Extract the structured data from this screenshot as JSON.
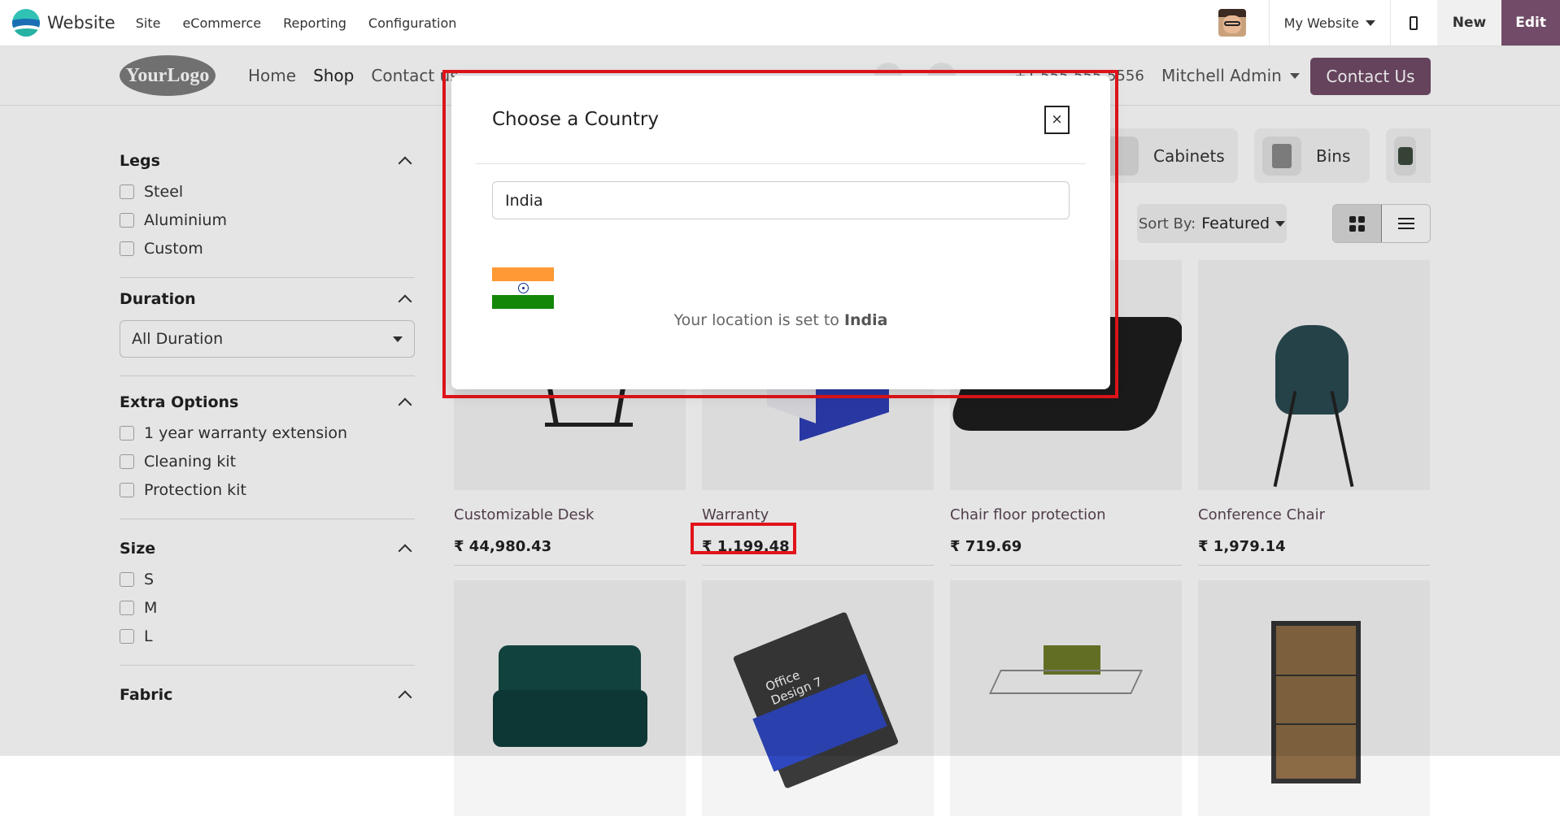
{
  "admin_bar": {
    "app_name": "Website",
    "menu": [
      "Site",
      "eCommerce",
      "Reporting",
      "Configuration"
    ],
    "website_selector": "My Website",
    "new_label": "New",
    "edit_label": "Edit",
    "accent_color": "#714b67"
  },
  "site_header": {
    "logo_text": "YourLogo",
    "nav": [
      "Home",
      "Shop",
      "Contact us"
    ],
    "active_nav": "Shop",
    "phone": "+1 555-555-5556",
    "user": "Mitchell Admin",
    "contact_button": "Contact Us"
  },
  "filters": {
    "legs": {
      "title": "Legs",
      "options": [
        "Steel",
        "Aluminium",
        "Custom"
      ]
    },
    "duration": {
      "title": "Duration",
      "selected": "All Duration"
    },
    "extra_options": {
      "title": "Extra Options",
      "options": [
        "1 year warranty extension",
        "Cleaning kit",
        "Protection kit"
      ]
    },
    "size": {
      "title": "Size",
      "options": [
        "S",
        "M",
        "L"
      ]
    },
    "fabric": {
      "title": "Fabric"
    }
  },
  "categories": [
    "Cabinets",
    "Bins"
  ],
  "sort": {
    "label": "Sort By:",
    "value": "Featured"
  },
  "products": [
    {
      "name": "Customizable Desk",
      "price": "₹ 44,980.43"
    },
    {
      "name": "Warranty",
      "price": "₹ 1,199.48"
    },
    {
      "name": "Chair floor protection",
      "price": "₹ 719.69"
    },
    {
      "name": "Conference Chair",
      "price": "₹ 1,979.14"
    }
  ],
  "product_art": {
    "office_design": "Office\nDesign 7"
  },
  "dialog": {
    "title": "Choose a Country",
    "close_symbol": "×",
    "input_value": "India",
    "message_prefix": "Your location is set to",
    "message_country": "India",
    "flag_colors": [
      "#ff9933",
      "#ffffff",
      "#138808"
    ]
  },
  "highlight_color": "#e1141a"
}
